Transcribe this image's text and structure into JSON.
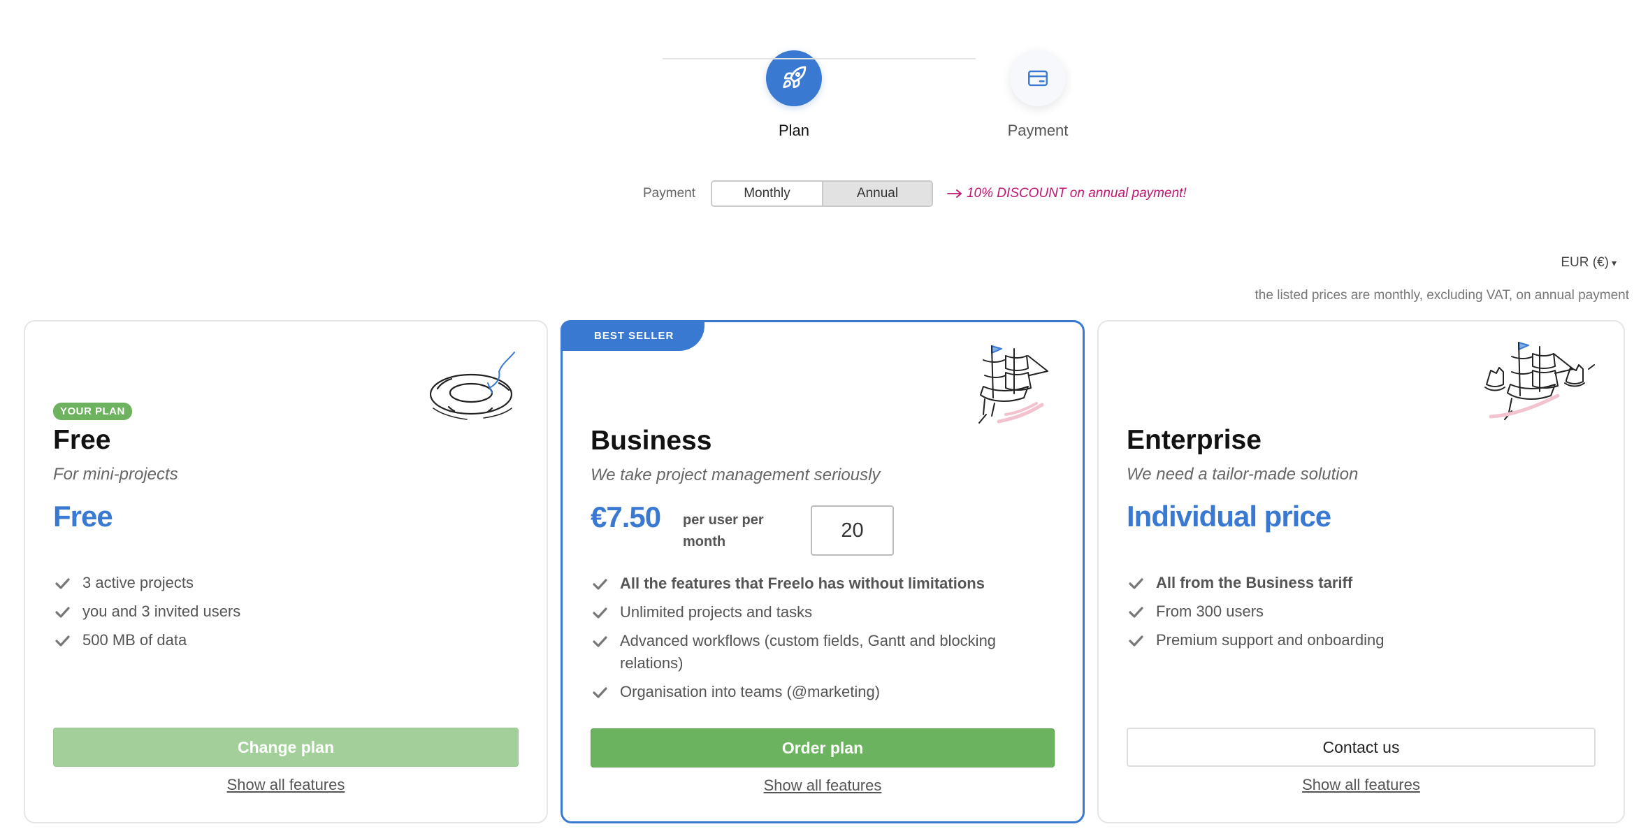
{
  "stepper": {
    "steps": [
      {
        "label": "Plan",
        "icon": "rocket-icon",
        "active": true
      },
      {
        "label": "Payment",
        "icon": "credit-card-icon",
        "active": false
      }
    ]
  },
  "billing": {
    "label": "Payment",
    "options": [
      "Monthly",
      "Annual"
    ],
    "selected": "Annual",
    "discount_note": "10% DISCOUNT on annual payment!"
  },
  "currency": {
    "label": "EUR (€)"
  },
  "price_note": "the listed prices are monthly, excluding VAT, on annual payment",
  "plans": [
    {
      "name": "Free",
      "badge": "YOUR PLAN",
      "subtitle": "For mini-projects",
      "price": "Free",
      "features": [
        "3 active projects",
        "you and 3 invited users",
        "500 MB of data"
      ],
      "cta": "Change plan",
      "show_all": "Show all features",
      "illustration": "life-ring-icon"
    },
    {
      "name": "Business",
      "ribbon": "BEST SELLER",
      "subtitle": "We take project management seriously",
      "price": "€7.50",
      "per_user": "per user per month",
      "quantity": "20",
      "features": [
        "All the features that Freelo has without limitations",
        "Unlimited projects and tasks",
        "Advanced workflows (custom fields, Gantt and blocking relations)",
        "Organisation into teams (@marketing)"
      ],
      "cta": "Order plan",
      "show_all": "Show all features",
      "illustration": "ship-icon"
    },
    {
      "name": "Enterprise",
      "subtitle": "We need a tailor-made solution",
      "price": "Individual price",
      "features": [
        "All from the Business tariff",
        "From 300 users",
        "Premium support and onboarding"
      ],
      "cta": "Contact us",
      "show_all": "Show all features",
      "illustration": "fleet-icon"
    }
  ],
  "colors": {
    "accent": "#3a79d1",
    "green": "#6bb35e",
    "discount": "#c01672"
  }
}
